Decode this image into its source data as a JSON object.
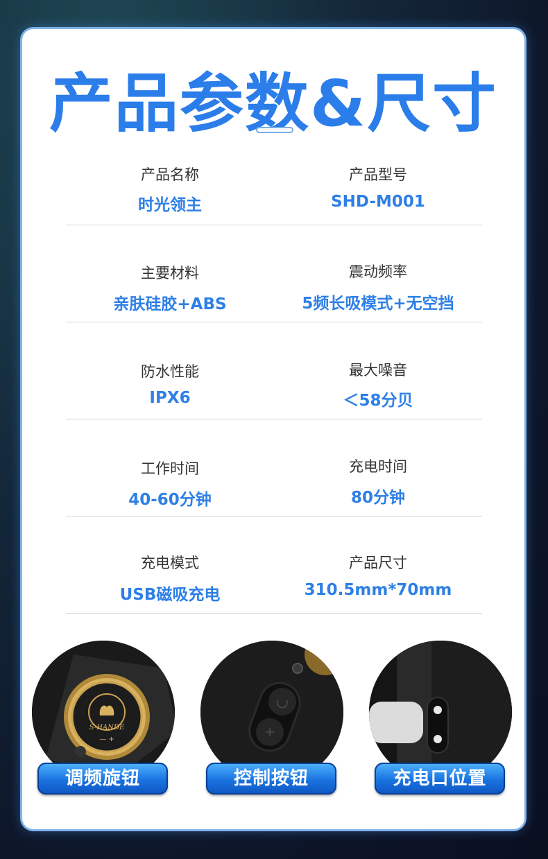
{
  "page_title": "产品参数&尺寸",
  "specs": [
    {
      "left": {
        "label": "产品名称",
        "value": "时光领主"
      },
      "right": {
        "label": "产品型号",
        "value": "SHD-M001"
      }
    },
    {
      "left": {
        "label": "主要材料",
        "value": "亲肤硅胶+ABS"
      },
      "right": {
        "label": "震动频率",
        "value": "5频长吸模式+无空挡"
      }
    },
    {
      "left": {
        "label": "防水性能",
        "value": "IPX6"
      },
      "right": {
        "label": "最大噪音",
        "value": "＜58分贝"
      }
    },
    {
      "left": {
        "label": "工作时间",
        "value": "40-60分钟"
      },
      "right": {
        "label": "充电时间",
        "value": "80分钟"
      }
    },
    {
      "left": {
        "label": "充电模式",
        "value": "USB磁吸充电"
      },
      "right": {
        "label": "产品尺寸",
        "value": "310.5mm*70mm"
      }
    }
  ],
  "features": [
    {
      "label": "调频旋钮",
      "knob_brand": "S-HANDE",
      "knob_markers": "— +"
    },
    {
      "label": "控制按钮"
    },
    {
      "label": "充电口位置"
    }
  ],
  "colors": {
    "accent": "#2b7de9",
    "value_text": "#2e7fe6",
    "badge": "#1a73e0"
  }
}
